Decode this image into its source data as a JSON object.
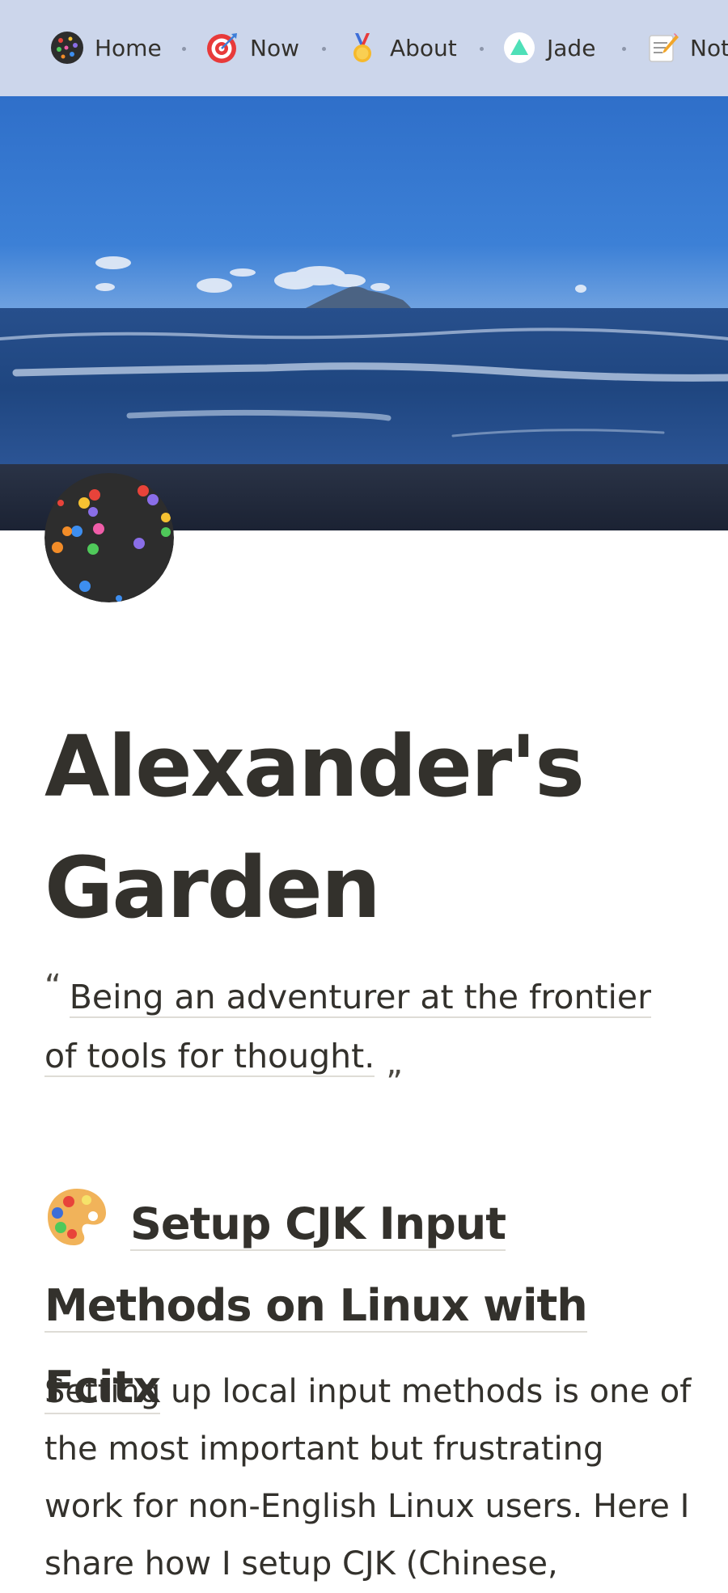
{
  "nav": {
    "items": [
      {
        "label": "Home",
        "icon": "confetti-dot-icon"
      },
      {
        "label": "Now",
        "icon": "target-icon"
      },
      {
        "label": "About",
        "icon": "medal-icon"
      },
      {
        "label": "Jade",
        "icon": "jade-triangle-icon"
      },
      {
        "label": "Notes",
        "icon": "memo-icon"
      }
    ]
  },
  "page": {
    "title": "Alexander's Garden",
    "tagline": "Being an adventurer at the frontier of tools for thought.",
    "quote_open": "“",
    "quote_close": "„"
  },
  "post": {
    "icon": "artist-palette-icon",
    "title": "Setup CJK Input Methods on Linux with Fcitx",
    "excerpt": "Setting up local input methods is one of the most important but frustrating work for non-English Linux users. Here I share how I setup CJK (Chinese,"
  },
  "colors": {
    "nav_bg": "#ccd6eb",
    "text": "#33312c",
    "avatar_bg": "#2d2d2d",
    "link_underline": "#dedcd6"
  }
}
